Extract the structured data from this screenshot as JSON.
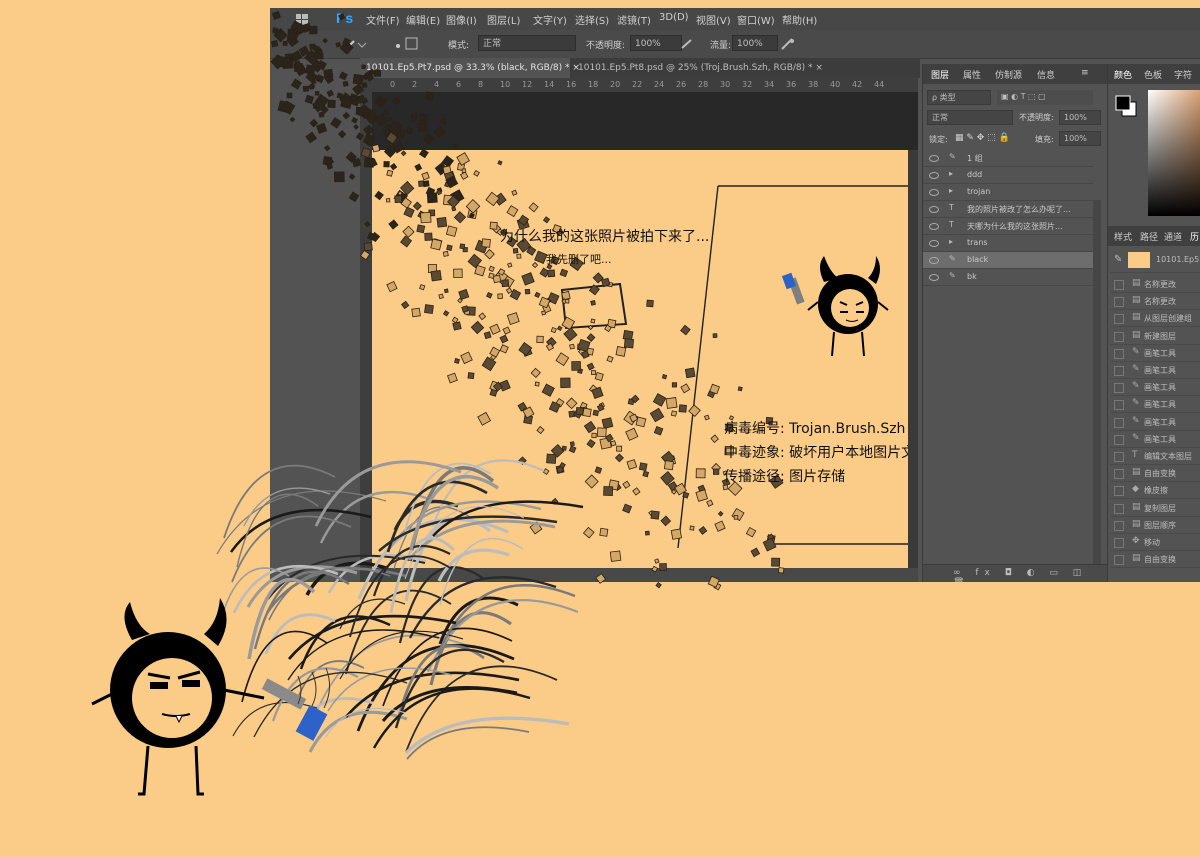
{
  "app": {
    "logo": "Ps",
    "window_icon": "windows-logo-icon"
  },
  "menu": {
    "items": [
      "文件(F)",
      "编辑(E)",
      "图像(I)",
      "图层(L)",
      "文字(Y)",
      "选择(S)",
      "滤镜(T)",
      "3D(D)",
      "视图(V)",
      "窗口(W)",
      "帮助(H)"
    ]
  },
  "options": {
    "mode_label": "模式:",
    "mode_value": "正常",
    "opacity_label": "不透明度:",
    "opacity_value": "100%",
    "flow_label": "流量:",
    "flow_value": "100%"
  },
  "tabs": [
    {
      "label": "10101.Ep5.Pt7.psd @ 33.3% (black, RGB/8) *",
      "active": true
    },
    {
      "label": "10101.Ep5.Pt8.psd @ 25% (Troj.Brush.Szh, RGB/8) *",
      "active": false
    }
  ],
  "ruler_ticks": [
    "0",
    "2",
    "4",
    "6",
    "8",
    "10",
    "12",
    "14",
    "16",
    "18",
    "20",
    "22",
    "24",
    "26",
    "28",
    "30",
    "32",
    "34",
    "36",
    "38",
    "40",
    "42",
    "44"
  ],
  "layers_panel": {
    "tabs": [
      "图层",
      "属性",
      "仿制源",
      "信息"
    ],
    "filter_value": "ρ 类型",
    "blend_value": "正常",
    "opacity_label": "不透明度:",
    "opacity_value": "100%",
    "lock_label": "锁定:",
    "fill_label": "填充:",
    "fill_value": "100%",
    "layers": [
      {
        "kind": "✎",
        "name": "1 组",
        "selected": false
      },
      {
        "kind": "▸",
        "name": "ddd",
        "selected": false
      },
      {
        "kind": "▸",
        "name": "trojan",
        "selected": false
      },
      {
        "kind": "T",
        "name": "我的照片被改了怎么办呢了...",
        "selected": false
      },
      {
        "kind": "T",
        "name": "天哪为什么我的这张照片...",
        "selected": false
      },
      {
        "kind": "▸",
        "name": "trans",
        "selected": false
      },
      {
        "kind": "✎",
        "name": "black",
        "selected": true
      },
      {
        "kind": "✎",
        "name": "bk",
        "selected": false
      }
    ]
  },
  "right_panel": {
    "tabs_top": [
      "颜色",
      "色板",
      "字符"
    ],
    "tabs_mid": [
      "样式",
      "路径",
      "通道",
      "历"
    ],
    "snapshot_label": "10101.Ep5.Pt7",
    "history": [
      {
        "icon": "▤",
        "name": "名称更改"
      },
      {
        "icon": "▤",
        "name": "名称更改"
      },
      {
        "icon": "▤",
        "name": "从图层创建组"
      },
      {
        "icon": "▤",
        "name": "新建图层"
      },
      {
        "icon": "✎",
        "name": "画笔工具"
      },
      {
        "icon": "✎",
        "name": "画笔工具"
      },
      {
        "icon": "✎",
        "name": "画笔工具"
      },
      {
        "icon": "✎",
        "name": "画笔工具"
      },
      {
        "icon": "✎",
        "name": "画笔工具"
      },
      {
        "icon": "✎",
        "name": "画笔工具"
      },
      {
        "icon": "T",
        "name": "编辑文本图层"
      },
      {
        "icon": "▤",
        "name": "自由变换"
      },
      {
        "icon": "◆",
        "name": "橡皮擦"
      },
      {
        "icon": "▤",
        "name": "复制图层"
      },
      {
        "icon": "▤",
        "name": "图层顺序"
      },
      {
        "icon": "✥",
        "name": "移动"
      },
      {
        "icon": "▤",
        "name": "自由变换"
      }
    ]
  },
  "canvas": {
    "speech_line1": "为什么我的这张照片被拍下来了...",
    "speech_line2": "我先删了吧...",
    "virus_id_label": "病毒编号: Trojan.Brush.Szh",
    "symptom_label": "中毒迹象: 破坏用户本地图片文",
    "spread_label": "传播途径: 图片存储"
  },
  "colors": {
    "background": "#FBCB88",
    "ps_blue": "#31A8FF",
    "brush_blue": "#2D63C9"
  }
}
